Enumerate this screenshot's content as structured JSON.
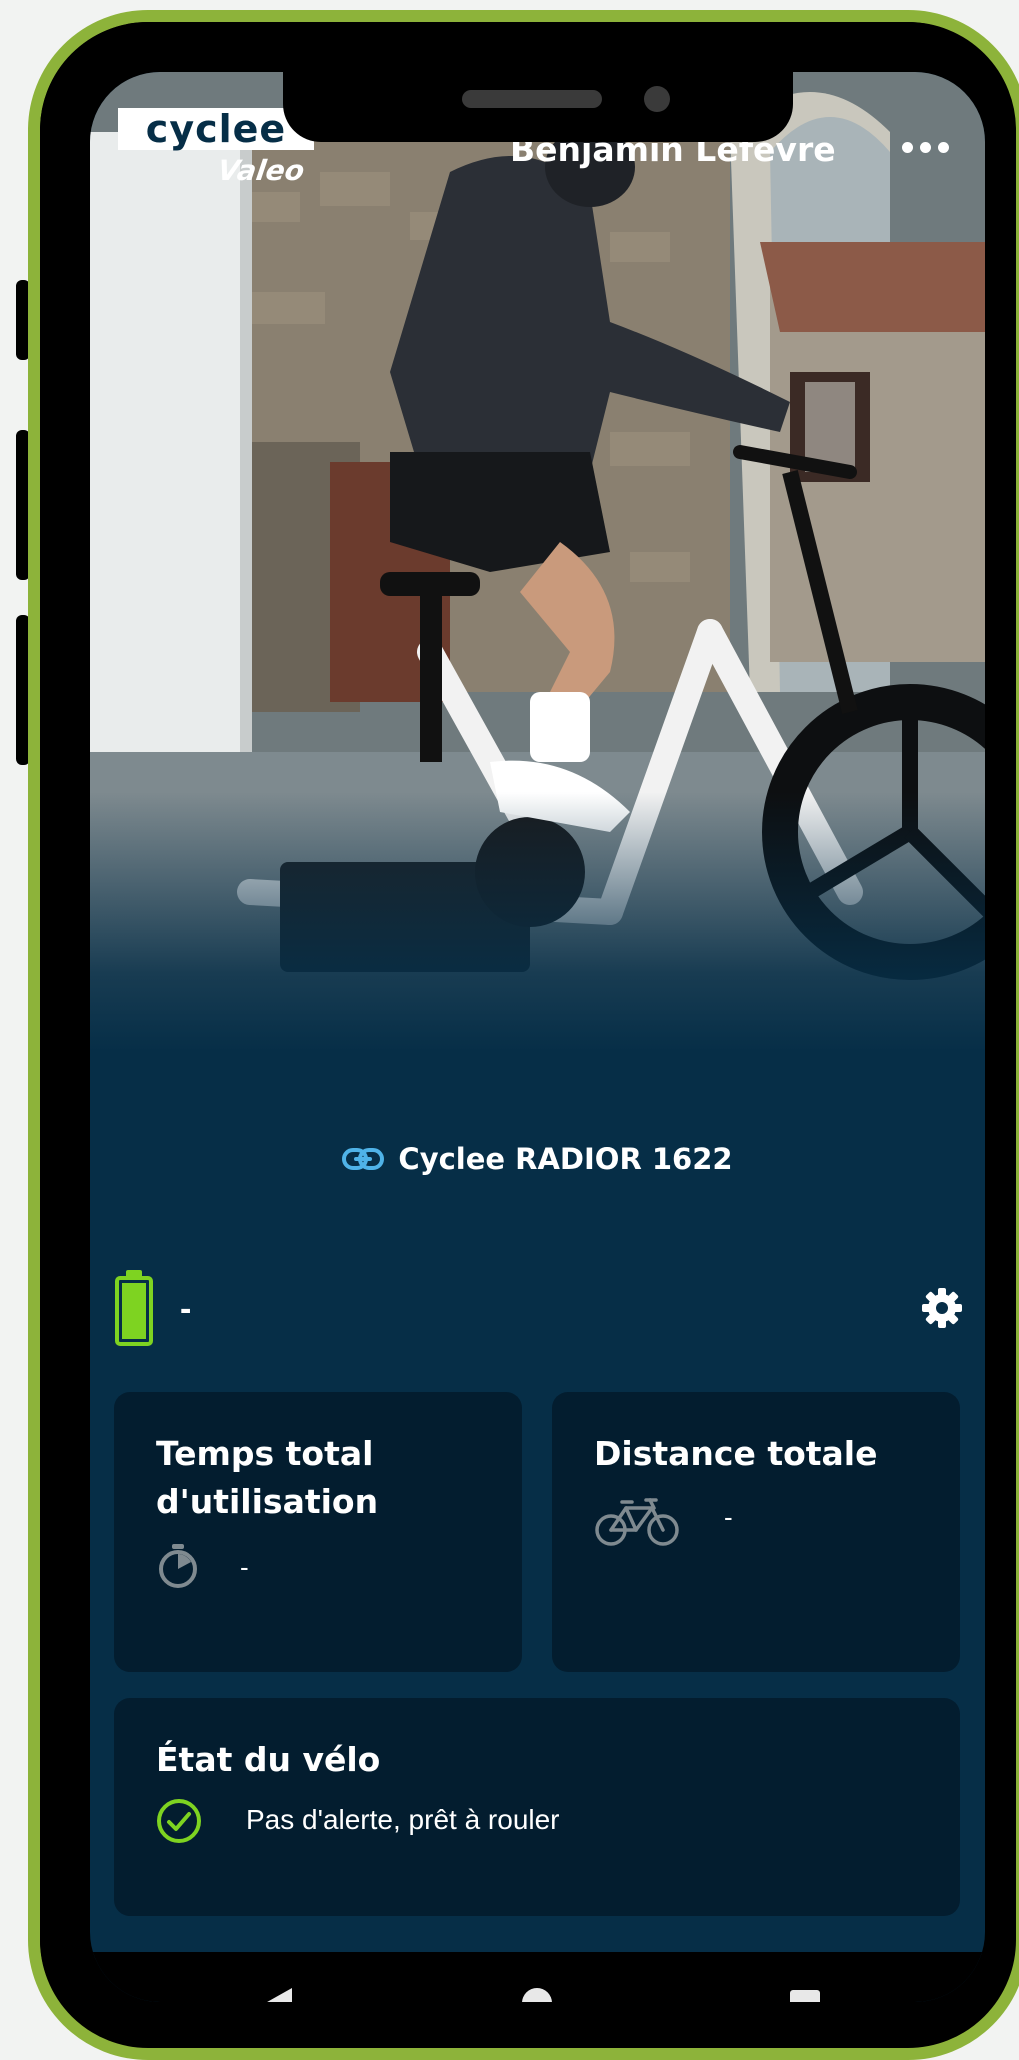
{
  "header": {
    "logo_text": "cyclee",
    "logo_sub": "Valeo",
    "user_name": "Benjamin Lefevre"
  },
  "bike": {
    "name": "Cyclee RADIOR 1622",
    "link_icon": "link-icon"
  },
  "battery": {
    "icon": "battery-icon",
    "value": "-",
    "level": 1.0,
    "color": "#7ed321"
  },
  "cards": {
    "usage_time": {
      "title_line1": "Temps total",
      "title_line2": "d'utilisation",
      "icon": "stopwatch-icon",
      "value": "-"
    },
    "distance": {
      "title": "Distance totale",
      "icon": "bicycle-icon",
      "value": "-"
    },
    "status": {
      "title": "État du vélo",
      "icon": "check-circle-icon",
      "message": "Pas d'alerte, prêt à rouler"
    }
  },
  "colors": {
    "frame": "#8db33a",
    "background": "#062e47",
    "card": "#031d2f",
    "accent_green": "#7ed321",
    "link_blue": "#4fb3e8"
  }
}
